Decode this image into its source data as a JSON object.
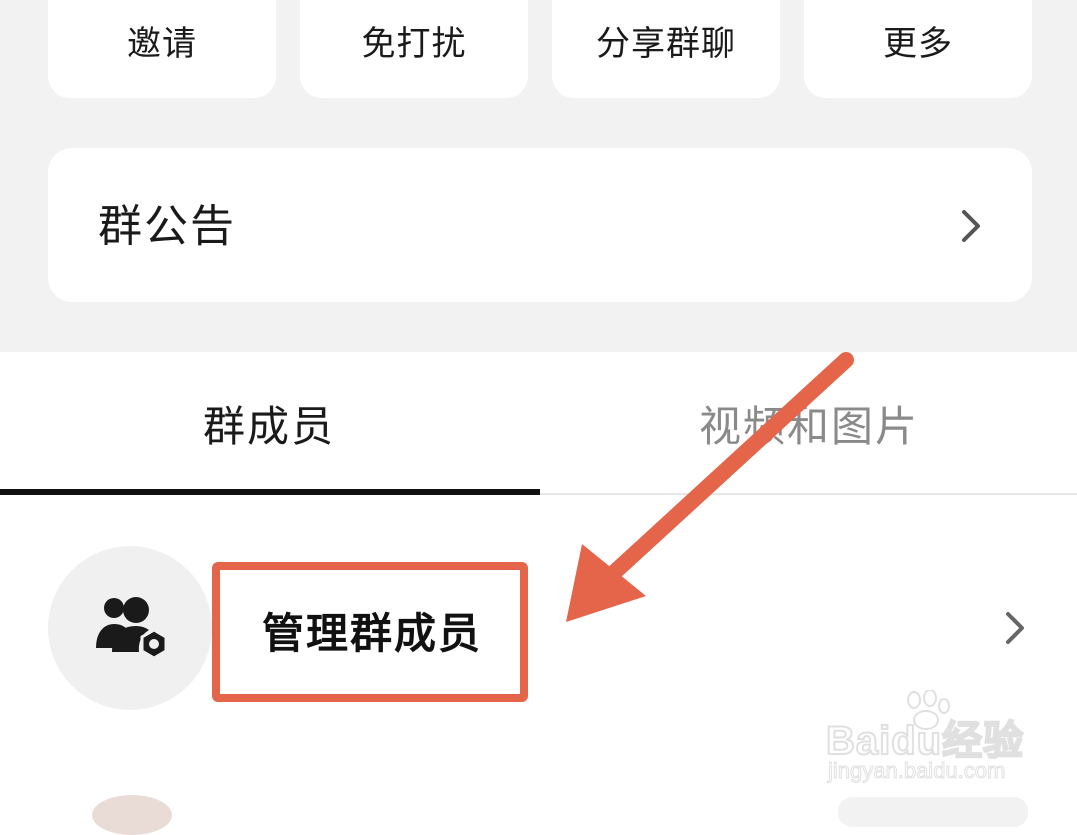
{
  "actions": [
    {
      "label": "邀请"
    },
    {
      "label": "免打扰"
    },
    {
      "label": "分享群聊"
    },
    {
      "label": "更多"
    }
  ],
  "notice": {
    "label": "群公告"
  },
  "tabs": [
    {
      "label": "群成员",
      "active": true
    },
    {
      "label": "视频和图片",
      "active": false
    }
  ],
  "manage": {
    "label": "管理群成员",
    "icon": "manage-members-icon"
  },
  "annotation": {
    "color": "#e4654a"
  },
  "watermark": {
    "logo": "Baidu经验",
    "url": "jingyan.baidu.com"
  }
}
